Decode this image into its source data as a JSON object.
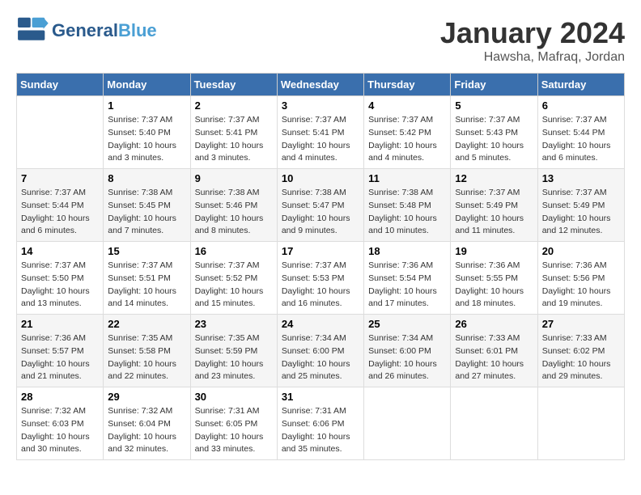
{
  "header": {
    "logo_general": "General",
    "logo_blue": "Blue",
    "title": "January 2024",
    "location": "Hawsha, Mafraq, Jordan"
  },
  "calendar": {
    "weekdays": [
      "Sunday",
      "Monday",
      "Tuesday",
      "Wednesday",
      "Thursday",
      "Friday",
      "Saturday"
    ],
    "weeks": [
      [
        {
          "day": "",
          "info": ""
        },
        {
          "day": "1",
          "info": "Sunrise: 7:37 AM\nSunset: 5:40 PM\nDaylight: 10 hours\nand 3 minutes."
        },
        {
          "day": "2",
          "info": "Sunrise: 7:37 AM\nSunset: 5:41 PM\nDaylight: 10 hours\nand 3 minutes."
        },
        {
          "day": "3",
          "info": "Sunrise: 7:37 AM\nSunset: 5:41 PM\nDaylight: 10 hours\nand 4 minutes."
        },
        {
          "day": "4",
          "info": "Sunrise: 7:37 AM\nSunset: 5:42 PM\nDaylight: 10 hours\nand 4 minutes."
        },
        {
          "day": "5",
          "info": "Sunrise: 7:37 AM\nSunset: 5:43 PM\nDaylight: 10 hours\nand 5 minutes."
        },
        {
          "day": "6",
          "info": "Sunrise: 7:37 AM\nSunset: 5:44 PM\nDaylight: 10 hours\nand 6 minutes."
        }
      ],
      [
        {
          "day": "7",
          "info": "Sunrise: 7:37 AM\nSunset: 5:44 PM\nDaylight: 10 hours\nand 6 minutes."
        },
        {
          "day": "8",
          "info": "Sunrise: 7:38 AM\nSunset: 5:45 PM\nDaylight: 10 hours\nand 7 minutes."
        },
        {
          "day": "9",
          "info": "Sunrise: 7:38 AM\nSunset: 5:46 PM\nDaylight: 10 hours\nand 8 minutes."
        },
        {
          "day": "10",
          "info": "Sunrise: 7:38 AM\nSunset: 5:47 PM\nDaylight: 10 hours\nand 9 minutes."
        },
        {
          "day": "11",
          "info": "Sunrise: 7:38 AM\nSunset: 5:48 PM\nDaylight: 10 hours\nand 10 minutes."
        },
        {
          "day": "12",
          "info": "Sunrise: 7:37 AM\nSunset: 5:49 PM\nDaylight: 10 hours\nand 11 minutes."
        },
        {
          "day": "13",
          "info": "Sunrise: 7:37 AM\nSunset: 5:49 PM\nDaylight: 10 hours\nand 12 minutes."
        }
      ],
      [
        {
          "day": "14",
          "info": "Sunrise: 7:37 AM\nSunset: 5:50 PM\nDaylight: 10 hours\nand 13 minutes."
        },
        {
          "day": "15",
          "info": "Sunrise: 7:37 AM\nSunset: 5:51 PM\nDaylight: 10 hours\nand 14 minutes."
        },
        {
          "day": "16",
          "info": "Sunrise: 7:37 AM\nSunset: 5:52 PM\nDaylight: 10 hours\nand 15 minutes."
        },
        {
          "day": "17",
          "info": "Sunrise: 7:37 AM\nSunset: 5:53 PM\nDaylight: 10 hours\nand 16 minutes."
        },
        {
          "day": "18",
          "info": "Sunrise: 7:36 AM\nSunset: 5:54 PM\nDaylight: 10 hours\nand 17 minutes."
        },
        {
          "day": "19",
          "info": "Sunrise: 7:36 AM\nSunset: 5:55 PM\nDaylight: 10 hours\nand 18 minutes."
        },
        {
          "day": "20",
          "info": "Sunrise: 7:36 AM\nSunset: 5:56 PM\nDaylight: 10 hours\nand 19 minutes."
        }
      ],
      [
        {
          "day": "21",
          "info": "Sunrise: 7:36 AM\nSunset: 5:57 PM\nDaylight: 10 hours\nand 21 minutes."
        },
        {
          "day": "22",
          "info": "Sunrise: 7:35 AM\nSunset: 5:58 PM\nDaylight: 10 hours\nand 22 minutes."
        },
        {
          "day": "23",
          "info": "Sunrise: 7:35 AM\nSunset: 5:59 PM\nDaylight: 10 hours\nand 23 minutes."
        },
        {
          "day": "24",
          "info": "Sunrise: 7:34 AM\nSunset: 6:00 PM\nDaylight: 10 hours\nand 25 minutes."
        },
        {
          "day": "25",
          "info": "Sunrise: 7:34 AM\nSunset: 6:00 PM\nDaylight: 10 hours\nand 26 minutes."
        },
        {
          "day": "26",
          "info": "Sunrise: 7:33 AM\nSunset: 6:01 PM\nDaylight: 10 hours\nand 27 minutes."
        },
        {
          "day": "27",
          "info": "Sunrise: 7:33 AM\nSunset: 6:02 PM\nDaylight: 10 hours\nand 29 minutes."
        }
      ],
      [
        {
          "day": "28",
          "info": "Sunrise: 7:32 AM\nSunset: 6:03 PM\nDaylight: 10 hours\nand 30 minutes."
        },
        {
          "day": "29",
          "info": "Sunrise: 7:32 AM\nSunset: 6:04 PM\nDaylight: 10 hours\nand 32 minutes."
        },
        {
          "day": "30",
          "info": "Sunrise: 7:31 AM\nSunset: 6:05 PM\nDaylight: 10 hours\nand 33 minutes."
        },
        {
          "day": "31",
          "info": "Sunrise: 7:31 AM\nSunset: 6:06 PM\nDaylight: 10 hours\nand 35 minutes."
        },
        {
          "day": "",
          "info": ""
        },
        {
          "day": "",
          "info": ""
        },
        {
          "day": "",
          "info": ""
        }
      ]
    ]
  }
}
